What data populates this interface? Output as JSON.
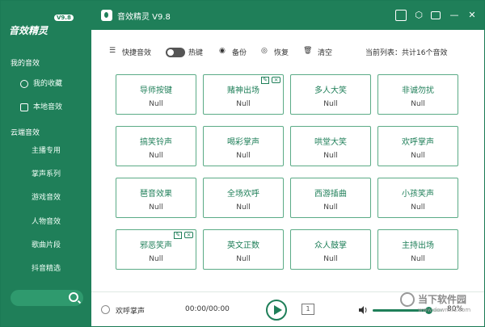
{
  "app": {
    "title": "音效精灵 V9.8",
    "logo_text": "音效精灵",
    "logo_version": "V9.8"
  },
  "sidebar": {
    "my_sounds_title": "我的音效",
    "my_items": [
      {
        "label": "我的收藏",
        "icon": "heart-icon"
      },
      {
        "label": "本地音效",
        "icon": "folder-icon"
      }
    ],
    "cloud_title": "云端音效",
    "cloud_items": [
      {
        "label": "主播专用"
      },
      {
        "label": "掌声系列"
      },
      {
        "label": "游戏音效"
      },
      {
        "label": "人物音效"
      },
      {
        "label": "歌曲片段"
      },
      {
        "label": "抖音精选"
      }
    ]
  },
  "toolbar": {
    "quick_sound": "快捷音效",
    "hotkey": "热键",
    "backup": "备份",
    "restore": "恢复",
    "clear": "清空",
    "list_info": "当前列表：共计16个音效"
  },
  "sounds": [
    {
      "name": "导师按键",
      "value": "Null"
    },
    {
      "name": "赌神出场",
      "value": "Null"
    },
    {
      "name": "多人大笑",
      "value": "Null"
    },
    {
      "name": "非诚勿扰",
      "value": "Null"
    },
    {
      "name": "搞笑铃声",
      "value": "Null"
    },
    {
      "name": "喝彩掌声",
      "value": "Null"
    },
    {
      "name": "哄堂大笑",
      "value": "Null"
    },
    {
      "name": "欢呼掌声",
      "value": "Null"
    },
    {
      "name": "琶音效果",
      "value": "Null"
    },
    {
      "name": "全场欢呼",
      "value": "Null"
    },
    {
      "name": "西游插曲",
      "value": "Null"
    },
    {
      "name": "小孩笑声",
      "value": "Null"
    },
    {
      "name": "邪恶笑声",
      "value": "Null"
    },
    {
      "name": "英文正数",
      "value": "Null"
    },
    {
      "name": "众人鼓掌",
      "value": "Null"
    },
    {
      "name": "主持出场",
      "value": "Null"
    }
  ],
  "player": {
    "now_playing": "欢呼掌声",
    "time": "00:00/00:00",
    "volume_percent": 80,
    "volume_text": "80%"
  },
  "watermark": {
    "text": "当下软件园",
    "sub": "www.downxia.com"
  },
  "colors": {
    "brand": "#1f7f59",
    "card_border": "#5bab86"
  }
}
